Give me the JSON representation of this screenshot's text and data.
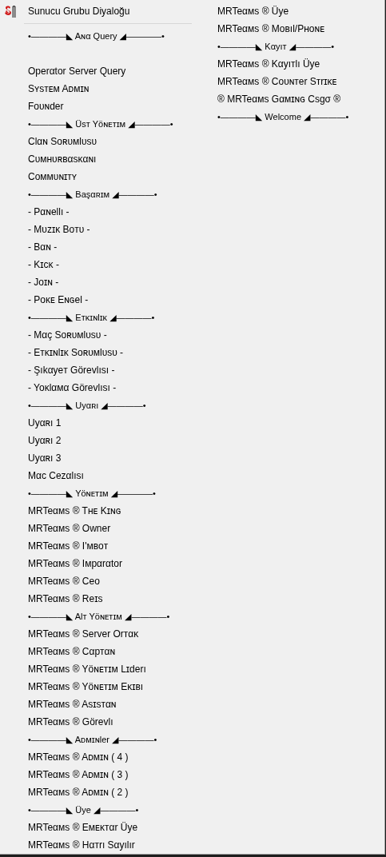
{
  "menu": {
    "columns": [
      {
        "items": [
          {
            "kind": "icon_item",
            "label": "Sunucu Grubu Diyaloğu"
          },
          {
            "kind": "separator"
          },
          {
            "kind": "header",
            "label": "•――――◣ Aɴα Query ◢――――•"
          },
          {
            "kind": "blank"
          },
          {
            "kind": "item",
            "label": "Operαtor Server Query"
          },
          {
            "kind": "item",
            "label": "Sʏsᴛᴇᴍ Aᴅᴍɪɴ"
          },
          {
            "kind": "item",
            "label": "Fᴏᴜɴder"
          },
          {
            "kind": "header",
            "label": "•――――◣ Üsᴛ Yöɴᴇᴛɪᴍ ◢――――•"
          },
          {
            "kind": "item",
            "label": "Clαɴ Soʀᴜᴍlᴜsᴜ"
          },
          {
            "kind": "item",
            "label": "Cᴜᴍʜᴜʀʙαsᴋαɴı"
          },
          {
            "kind": "item",
            "label": "Cᴏᴍᴍᴜɴɪᴛʏ"
          },
          {
            "kind": "header",
            "label": "•――――◣ Başαʀɪᴍ ◢――――•"
          },
          {
            "kind": "item",
            "label": "- Pαɴellı -"
          },
          {
            "kind": "item",
            "label": "- Mᴜᴢɪᴋ Boᴛᴜ -"
          },
          {
            "kind": "item",
            "label": "- Bαɴ -"
          },
          {
            "kind": "item",
            "label": "- Kɪᴄᴋ -"
          },
          {
            "kind": "item",
            "label": "- Joɪɴ -"
          },
          {
            "kind": "item",
            "label": "- Poᴋᴇ Eɴɢel -"
          },
          {
            "kind": "header",
            "label": "•――――◣ Eᴛᴋɪɴlɪᴋ ◢――――•"
          },
          {
            "kind": "item",
            "label": "- Mαç Soʀᴜᴍlᴜsᴜ -"
          },
          {
            "kind": "item",
            "label": "- Eᴛᴋɪɴlɪᴋ Soʀᴜᴍlᴜsᴜ -"
          },
          {
            "kind": "item",
            "label": "- Şıkαyeᴛ Görevlısı -"
          },
          {
            "kind": "item",
            "label": "- Yoᴋlαᴍα Görevlısı -"
          },
          {
            "kind": "header",
            "label": "•――――◣ Uyαʀı ◢――――•"
          },
          {
            "kind": "item",
            "label": "Uyαʀı 1"
          },
          {
            "kind": "item",
            "label": "Uyαʀı 2"
          },
          {
            "kind": "item",
            "label": "Uyαʀı 3"
          },
          {
            "kind": "item",
            "label": "Mαc Cezαlısı"
          },
          {
            "kind": "header",
            "label": "•――――◣ Yöɴᴇᴛɪᴍ ◢――――•"
          },
          {
            "kind": "item",
            "label": "MRTeαᴍs ® Tʜᴇ Kɪɴɢ"
          },
          {
            "kind": "item",
            "label": "MRTeαᴍs ® Owner"
          },
          {
            "kind": "item",
            "label": "MRTeαᴍs ® I'ᴍʙoᴛ"
          },
          {
            "kind": "item",
            "label": "MRTeαᴍs ® Iᴍpαrαtor"
          },
          {
            "kind": "item",
            "label": "MRTeαᴍs ® Ceo"
          },
          {
            "kind": "item",
            "label": "MRTeαᴍs ® Reɪs"
          },
          {
            "kind": "header",
            "label": "•――――◣ Alᴛ Yöɴᴇᴛɪᴍ ◢――――•"
          },
          {
            "kind": "item",
            "label": "MRTeαᴍs ® Server Orᴛαᴋ"
          },
          {
            "kind": "item",
            "label": "MRTeαᴍs ® Cαpᴛαɴ"
          },
          {
            "kind": "item",
            "label": "MRTeαᴍs ® Yöɴᴇᴛɪᴍ Lɪderı"
          },
          {
            "kind": "item",
            "label": "MRTeαᴍs ® Yöɴᴇᴛɪᴍ Eᴋɪʙı"
          },
          {
            "kind": "item",
            "label": "MRTeαᴍs ® Asɪsᴛαɴ"
          },
          {
            "kind": "item",
            "label": "MRTeαᴍs ® Görevlı"
          },
          {
            "kind": "header",
            "label": "•――――◣ Aᴅᴍɪɴler ◢――――•"
          },
          {
            "kind": "item",
            "label": "MRTeαᴍs ® Aᴅᴍɪɴ ( 4 )"
          },
          {
            "kind": "item",
            "label": "MRTeαᴍs ® Aᴅᴍɪɴ ( 3 )"
          },
          {
            "kind": "item",
            "label": "MRTeαᴍs ® Aᴅᴍɪɴ ( 2 )"
          },
          {
            "kind": "header",
            "label": "•――――◣ Üye ◢――――•"
          },
          {
            "kind": "item",
            "label": "MRTeαᴍs ® Eᴍᴇᴋᴛαr Üye"
          },
          {
            "kind": "item",
            "label": "MRTeαᴍs ® Hαᴛrı Sαyılır"
          }
        ]
      },
      {
        "items": [
          {
            "kind": "item",
            "label": "MRTeαᴍs ® Üye"
          },
          {
            "kind": "item",
            "label": "MRTeαᴍs ® Moʙıl/Pʜoɴᴇ"
          },
          {
            "kind": "header",
            "label": "•――――◣ Kαyıᴛ ◢――――•"
          },
          {
            "kind": "item",
            "label": "MRTeαᴍs ® Kαyıᴛlı Üye"
          },
          {
            "kind": "item",
            "label": "MRTeαᴍs ® Coᴜɴᴛer Sᴛrɪᴋᴇ"
          },
          {
            "kind": "item",
            "label": "® MRTeαᴍs Gαᴍɪɴɢ Csgσ ®"
          },
          {
            "kind": "header",
            "label": "•――――◣ Welcome ◢――――•"
          }
        ]
      }
    ]
  }
}
